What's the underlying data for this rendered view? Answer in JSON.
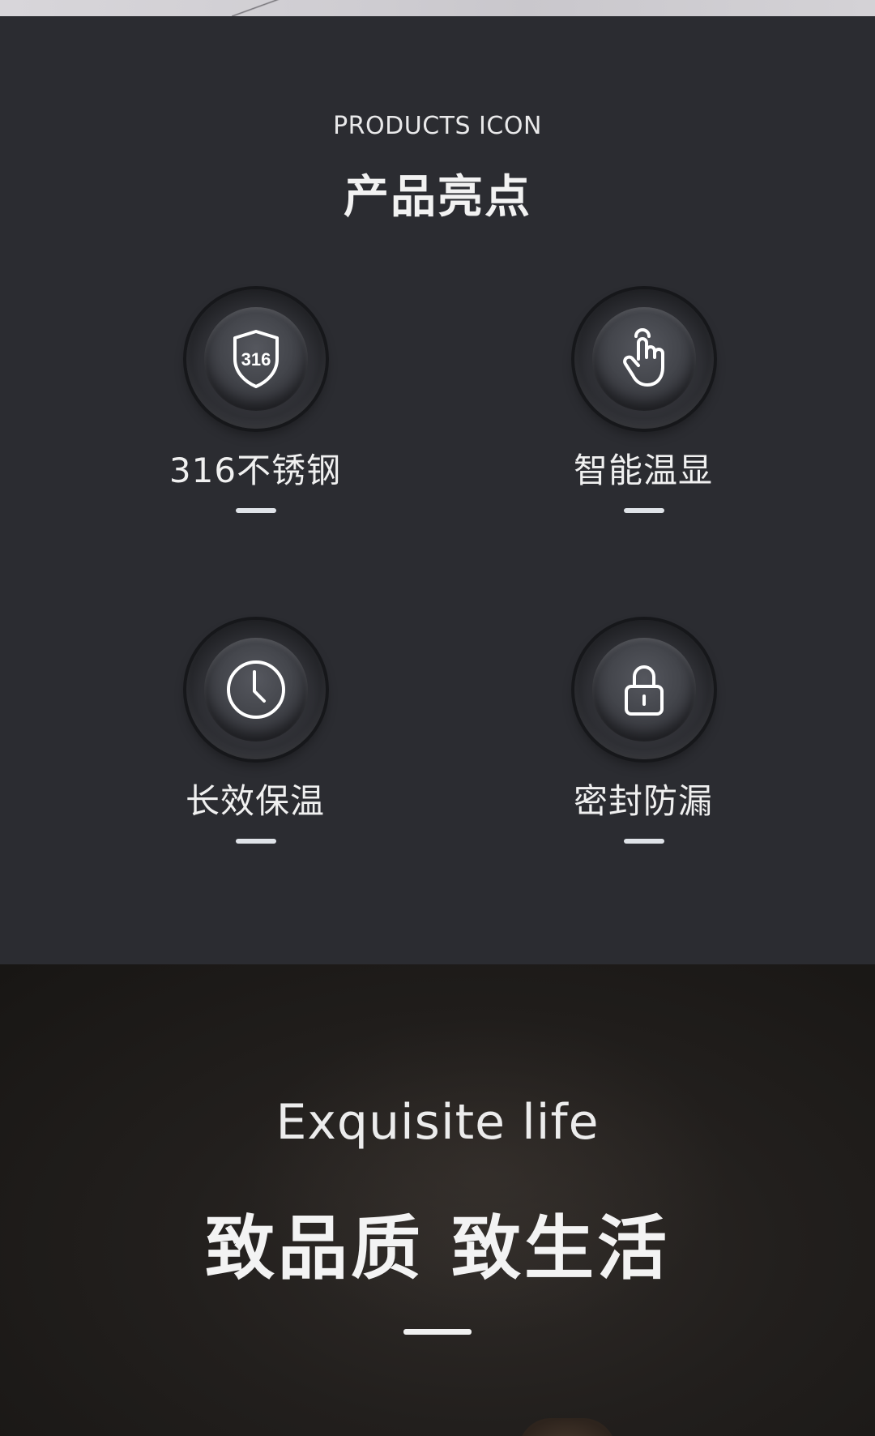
{
  "products": {
    "subtitle": "PRODUCTS ICON",
    "title": "产品亮点",
    "features": [
      {
        "label": "316不锈钢",
        "icon": "shield-316-icon",
        "icon_text": "316"
      },
      {
        "label": "智能温显",
        "icon": "touch-hand-icon"
      },
      {
        "label": "长效保温",
        "icon": "clock-icon"
      },
      {
        "label": "密封防漏",
        "icon": "lock-icon"
      }
    ]
  },
  "lifestyle": {
    "subtitle": "Exquisite life",
    "title": "致品质 致生活"
  },
  "colors": {
    "background": "#2b2c31",
    "text": "#f0f0f0",
    "accent_dash": "#dfe3e8"
  }
}
